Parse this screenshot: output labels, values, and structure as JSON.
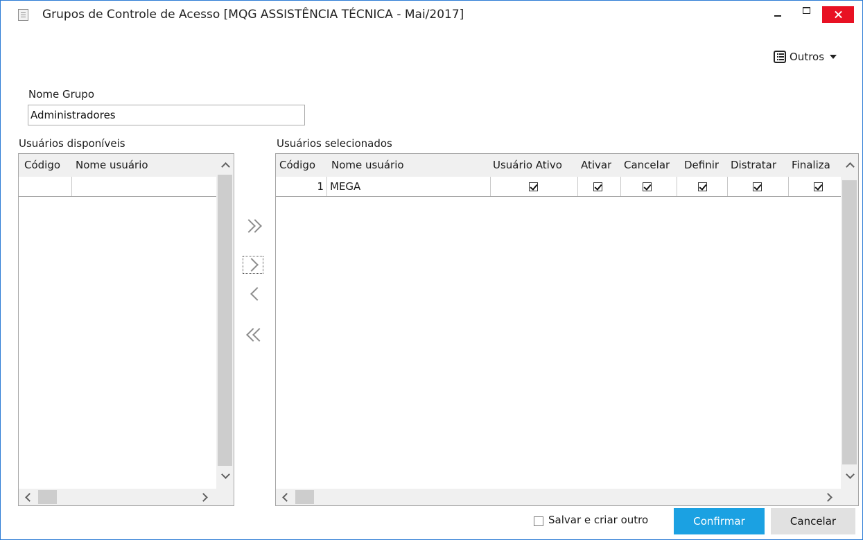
{
  "window": {
    "title": "Grupos de Controle de Acesso [MQG ASSISTÊNCIA TÉCNICA - Mai/2017]"
  },
  "toolbar": {
    "outros_label": "Outros",
    "outros_icon": "list-icon"
  },
  "form": {
    "nome_grupo_label": "Nome Grupo",
    "nome_grupo_value": "Administradores"
  },
  "available": {
    "title": "Usuários disponíveis",
    "columns": [
      "Código",
      "Nome usuário"
    ],
    "rows": []
  },
  "selected": {
    "title": "Usuários selecionados",
    "columns": [
      "Código",
      "Nome usuário",
      "Usuário Ativo",
      "Ativar",
      "Cancelar",
      "Definir",
      "Distratar",
      "Finaliza"
    ],
    "rows": [
      {
        "codigo": "1",
        "nome": "MEGA",
        "usuario_ativo": true,
        "ativar": true,
        "cancelar": true,
        "definir": true,
        "distratar": true,
        "finaliza": true
      }
    ]
  },
  "transfer_buttons": [
    {
      "name": "add-all",
      "icon": "double-chevron-right-icon"
    },
    {
      "name": "add-selected",
      "icon": "chevron-right-icon"
    },
    {
      "name": "remove-selected",
      "icon": "chevron-left-icon"
    },
    {
      "name": "remove-all",
      "icon": "double-chevron-left-icon"
    }
  ],
  "footer": {
    "save_and_new_label": "Salvar e criar outro",
    "save_and_new_checked": false,
    "confirm_label": "Confirmar",
    "cancel_label": "Cancelar"
  },
  "colors": {
    "accent": "#1ba1e2",
    "close": "#e81123",
    "border": "#2b7bd4"
  }
}
